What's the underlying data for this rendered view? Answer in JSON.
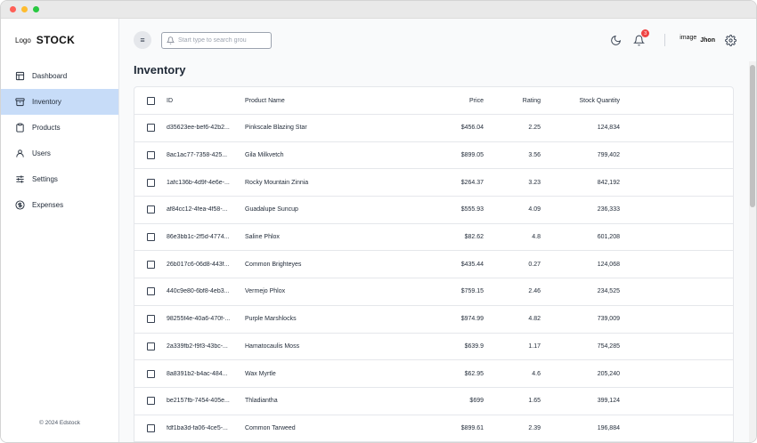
{
  "brand": {
    "logo": "Logo",
    "name": "STOCK"
  },
  "sidebar": {
    "items": [
      {
        "label": "Dashboard",
        "icon": "layout-icon"
      },
      {
        "label": "Inventory",
        "icon": "archive-icon",
        "active": true
      },
      {
        "label": "Products",
        "icon": "clipboard-icon"
      },
      {
        "label": "Users",
        "icon": "user-icon"
      },
      {
        "label": "Settings",
        "icon": "sliders-icon"
      },
      {
        "label": "Expenses",
        "icon": "dollar-circle-icon"
      }
    ],
    "footer": "© 2024 Edstock"
  },
  "topbar": {
    "menu_icon": "menu-icon",
    "search_placeholder": "Start type to search grou",
    "notifications_count": "3",
    "avatar_text": "image",
    "user_name": "Jhon"
  },
  "page": {
    "title": "Inventory"
  },
  "table": {
    "columns": [
      "ID",
      "Product Name",
      "Price",
      "Rating",
      "Stock Quantity"
    ],
    "rows": [
      {
        "id": "d35623ee-bef6-42b2...",
        "name": "Pinkscale Blazing Star",
        "price": "$456.04",
        "rating": "2.25",
        "stock": "124,834"
      },
      {
        "id": "8ac1ac77-7358-425...",
        "name": "Gila Milkvetch",
        "price": "$899.05",
        "rating": "3.56",
        "stock": "799,402"
      },
      {
        "id": "1afc136b-4d9f-4e6e-...",
        "name": "Rocky Mountain Zinnia",
        "price": "$264.37",
        "rating": "3.23",
        "stock": "842,192"
      },
      {
        "id": "af84cc12-4fea-4f58-...",
        "name": "Guadalupe Suncup",
        "price": "$555.93",
        "rating": "4.09",
        "stock": "236,333"
      },
      {
        "id": "86e3bb1c-2f5d-4774...",
        "name": "Saline Phlox",
        "price": "$82.62",
        "rating": "4.8",
        "stock": "601,208"
      },
      {
        "id": "26b017c6-06d8-443f...",
        "name": "Common Brighteyes",
        "price": "$435.44",
        "rating": "0.27",
        "stock": "124,068"
      },
      {
        "id": "440c9e80-6bf8-4eb3...",
        "name": "Vermejo Phlox",
        "price": "$759.15",
        "rating": "2.46",
        "stock": "234,525"
      },
      {
        "id": "98255f4e-40a6-470f-...",
        "name": "Purple Marshlocks",
        "price": "$974.99",
        "rating": "4.82",
        "stock": "739,009"
      },
      {
        "id": "2a339fb2-f9f3-43bc-...",
        "name": "Hamatocaulis Moss",
        "price": "$639.9",
        "rating": "1.17",
        "stock": "754,285"
      },
      {
        "id": "8a8391b2-b4ac-484...",
        "name": "Wax Myrtle",
        "price": "$62.95",
        "rating": "4.6",
        "stock": "205,240"
      },
      {
        "id": "be2157fb-7454-405e...",
        "name": "Thladiantha",
        "price": "$699",
        "rating": "1.65",
        "stock": "399,124"
      },
      {
        "id": "fdf1ba3d-fa06-4ce5-...",
        "name": "Common Tarweed",
        "price": "$899.61",
        "rating": "2.39",
        "stock": "196,884"
      }
    ]
  }
}
